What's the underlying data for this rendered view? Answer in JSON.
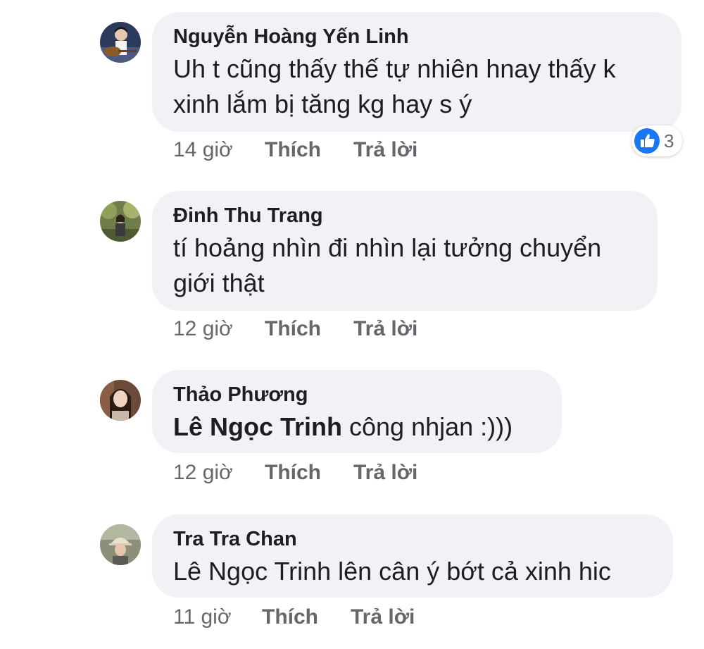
{
  "comments": [
    {
      "author": "Nguyễn Hoàng Yến Linh",
      "text": "Uh t cũng thấy thế tự nhiên hnay thấy k xinh lắm bị tăng kg hay s ý",
      "time": "14 giờ",
      "like_label": "Thích",
      "reply_label": "Trả lời",
      "reaction_count": "3",
      "reaction_icon": "like-icon"
    },
    {
      "author": "Đinh Thu Trang",
      "text": "tí hoảng nhìn đi nhìn lại tưởng chuyển giới thật",
      "time": "12 giờ",
      "like_label": "Thích",
      "reply_label": "Trả lời"
    },
    {
      "author": "Thảo Phương",
      "mention": "Lê Ngọc Trinh",
      "text": " công nhjan :)))",
      "time": "12 giờ",
      "like_label": "Thích",
      "reply_label": "Trả lời"
    },
    {
      "author": "Tra Tra Chan",
      "text": "Lê Ngọc Trinh lên cân ý bớt cả xinh hic",
      "time": "11 giờ",
      "like_label": "Thích",
      "reply_label": "Trả lời"
    }
  ],
  "colors": {
    "bubble": "#f0f2f5",
    "meta_text": "#65676b",
    "like_blue": "#1877f2"
  }
}
